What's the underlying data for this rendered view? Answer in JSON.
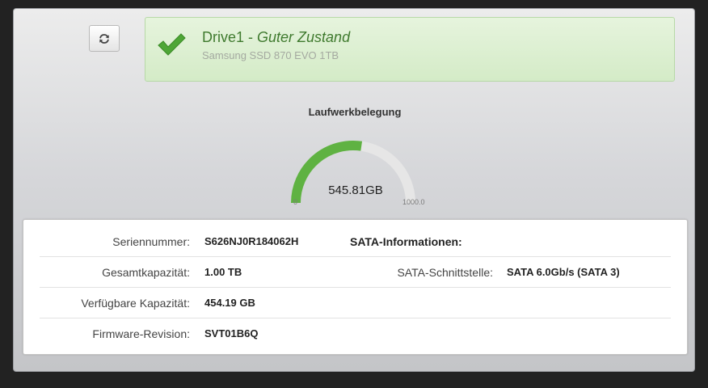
{
  "drive": {
    "name": "Drive1",
    "separator": " - ",
    "state": "Guter Zustand",
    "model": "Samsung SSD 870 EVO 1TB",
    "status_color": "#3f7a2e"
  },
  "toolbar": {
    "refresh_icon": "refresh-icon"
  },
  "gauge": {
    "title": "Laufwerkbelegung",
    "value_label": "545.81GB",
    "value": 545.81,
    "min": 0,
    "max": 1000,
    "min_label": "0",
    "max_label": "1000.0",
    "fill_color": "#5fb242",
    "track_color": "#e6e6e6"
  },
  "info": {
    "rows": [
      {
        "label": "Seriennummer:",
        "value": "S626NJ0R184062H"
      },
      {
        "label": "Gesamtkapazität:",
        "value": "1.00 TB"
      },
      {
        "label": "Verfügbare Kapazität:",
        "value": "454.19 GB"
      },
      {
        "label": "Firmware-Revision:",
        "value": "SVT01B6Q"
      }
    ],
    "sata": {
      "header": "SATA-Informationen:",
      "interface_label": "SATA-Schnittstelle:",
      "interface_value": "SATA 6.0Gb/s (SATA 3)"
    }
  }
}
